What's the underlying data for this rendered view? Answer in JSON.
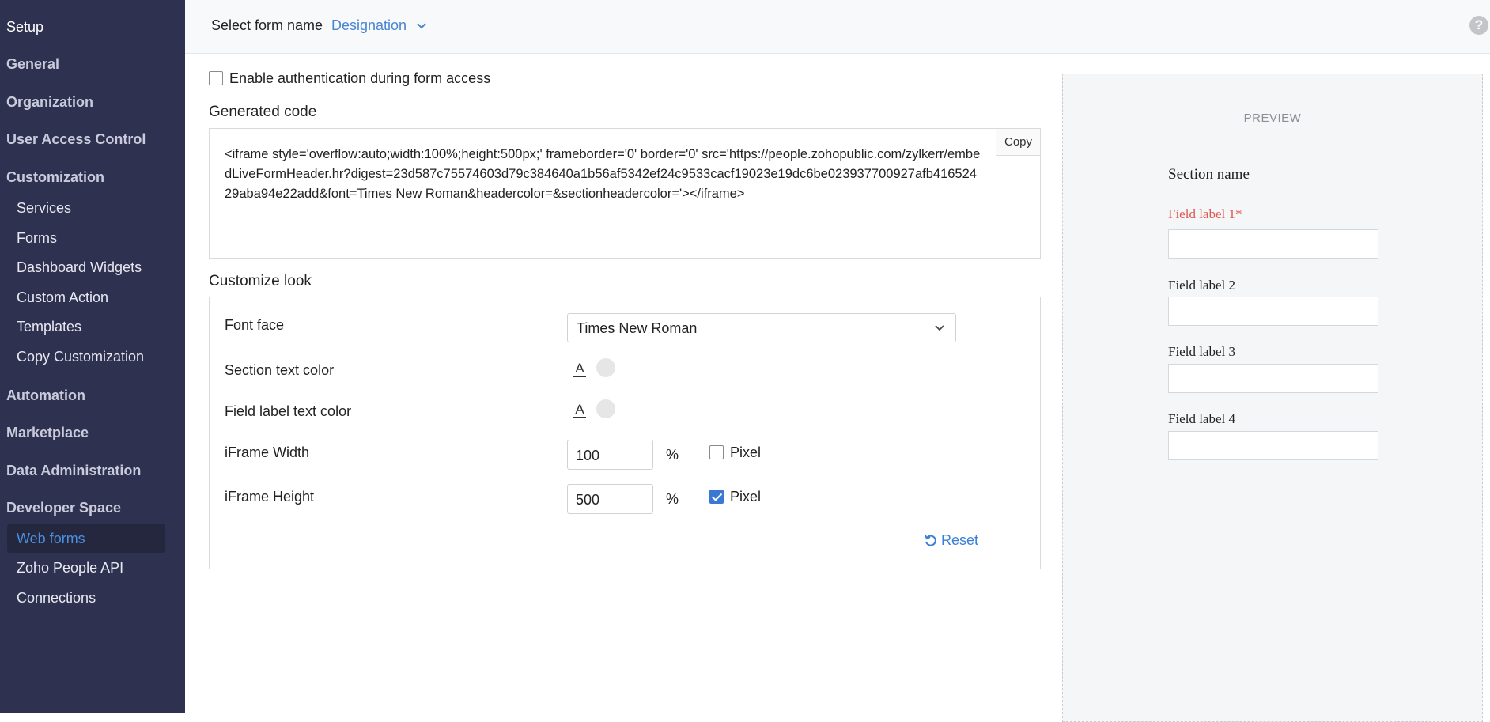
{
  "sidebar": {
    "setup": "Setup",
    "general": "General",
    "organization": "Organization",
    "user_access_control": "User Access Control",
    "customization": "Customization",
    "customization_items": [
      "Services",
      "Forms",
      "Dashboard Widgets",
      "Custom Action",
      "Templates",
      "Copy Customization"
    ],
    "automation": "Automation",
    "marketplace": "Marketplace",
    "data_administration": "Data Administration",
    "developer_space": "Developer Space",
    "developer_items": [
      "Web forms",
      "Zoho People API",
      "Connections"
    ],
    "active_item": "Web forms"
  },
  "header": {
    "select_label": "Select form name",
    "selected_form": "Designation",
    "help_icon": "?"
  },
  "auth": {
    "label": "Enable authentication during form access",
    "checked": false
  },
  "generated_code": {
    "title": "Generated code",
    "copy_label": "Copy",
    "code": "<iframe style='overflow:auto;width:100%;height:500px;' frameborder='0' border='0' src='https://people.zohopublic.com/zylkerr/embedLiveFormHeader.hr?digest=23d587c75574603d79c384640a1b56af5342ef24c9533cacf19023e19dc6be023937700927afb41652429aba94e22add&font=Times New Roman&headercolor=&sectionheadercolor='></iframe>"
  },
  "customize": {
    "title": "Customize look",
    "font_face_label": "Font face",
    "font_face_value": "Times New Roman",
    "section_text_color_label": "Section text color",
    "field_label_text_color_label": "Field label text color",
    "color_icon_glyph": "A",
    "iframe_width_label": "iFrame Width",
    "iframe_width_value": "100",
    "iframe_height_label": "iFrame Height",
    "iframe_height_value": "500",
    "percent": "%",
    "pixel_label": "Pixel",
    "width_pixel_checked": false,
    "height_pixel_checked": true,
    "reset_label": "Reset"
  },
  "preview": {
    "title": "PREVIEW",
    "section_name": "Section name",
    "fields": [
      "Field label 1*",
      "Field label 2",
      "Field label 3",
      "Field label 4"
    ]
  },
  "colors": {
    "sidebar_bg": "#2f3150",
    "accent": "#3a7fd8",
    "required_label": "#e0574f"
  }
}
